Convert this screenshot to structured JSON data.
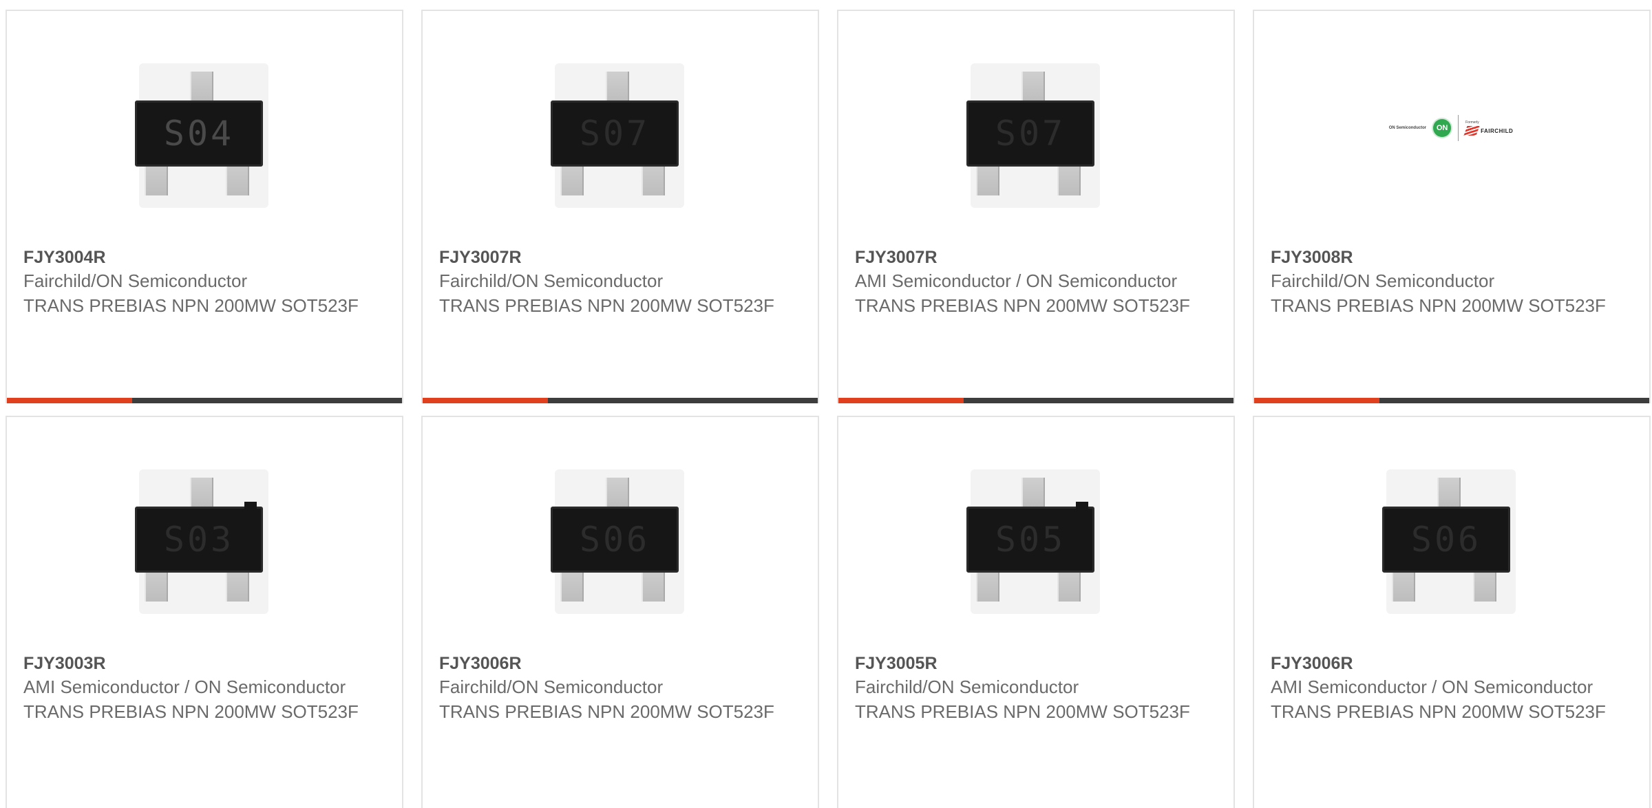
{
  "colors": {
    "accent": "#e0401e",
    "bar": "#3d3d3d",
    "border": "#e3e3e3",
    "text": "#6a6a6a"
  },
  "products": [
    {
      "part_number": "FJY3004R",
      "manufacturer": "Fairchild/ON Semiconductor",
      "description": "TRANS PREBIAS NPN 200MW SOT523F",
      "image": {
        "type": "transistor",
        "marking": "S04"
      }
    },
    {
      "part_number": "FJY3007R",
      "manufacturer": "Fairchild/ON Semiconductor",
      "description": "TRANS PREBIAS NPN 200MW SOT523F",
      "image": {
        "type": "transistor",
        "marking": "S07"
      }
    },
    {
      "part_number": "FJY3007R",
      "manufacturer": "AMI Semiconductor / ON Semiconductor",
      "description": "TRANS PREBIAS NPN 200MW SOT523F",
      "image": {
        "type": "transistor",
        "marking": "S07"
      }
    },
    {
      "part_number": "FJY3008R",
      "manufacturer": "Fairchild/ON Semiconductor",
      "description": "TRANS PREBIAS NPN 200MW SOT523F",
      "image": {
        "type": "logo",
        "logo_text": "ON Semiconductor",
        "logo_badge": "ON",
        "logo_formerly": "Formerly",
        "logo_brand": "FAIRCHILD"
      }
    },
    {
      "part_number": "FJY3003R",
      "manufacturer": "AMI Semiconductor / ON Semiconductor",
      "description": "TRANS PREBIAS NPN 200MW SOT523F",
      "image": {
        "type": "transistor",
        "marking": "S03"
      }
    },
    {
      "part_number": "FJY3006R",
      "manufacturer": "Fairchild/ON Semiconductor",
      "description": "TRANS PREBIAS NPN 200MW SOT523F",
      "image": {
        "type": "transistor",
        "marking": "S06"
      }
    },
    {
      "part_number": "FJY3005R",
      "manufacturer": "Fairchild/ON Semiconductor",
      "description": "TRANS PREBIAS NPN 200MW SOT523F",
      "image": {
        "type": "transistor",
        "marking": "S05"
      }
    },
    {
      "part_number": "FJY3006R",
      "manufacturer": "AMI Semiconductor / ON Semiconductor",
      "description": "TRANS PREBIAS NPN 200MW SOT523F",
      "image": {
        "type": "transistor",
        "marking": "S06"
      }
    }
  ]
}
